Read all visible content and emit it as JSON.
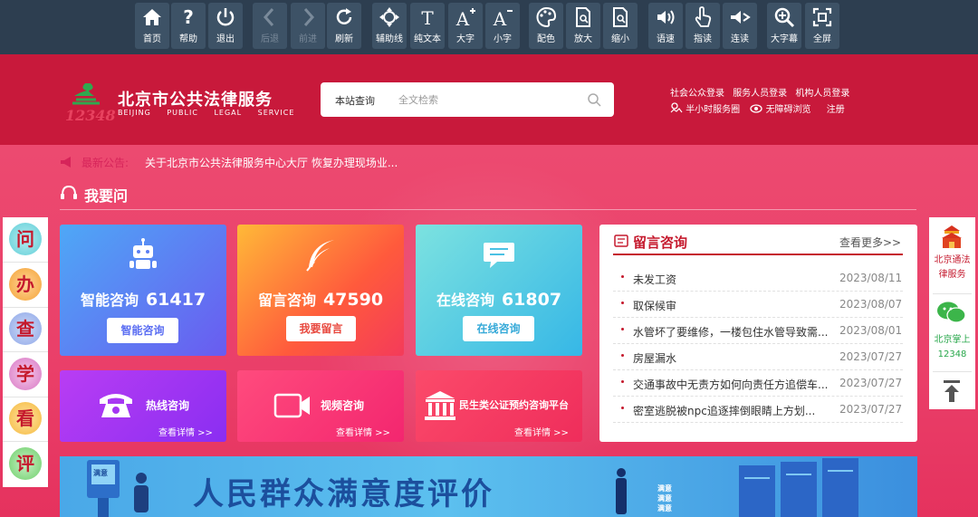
{
  "toolbar": [
    {
      "label": "首页",
      "icon": "home-icon",
      "disabled": false
    },
    {
      "label": "帮助",
      "icon": "help-icon",
      "disabled": false
    },
    {
      "label": "退出",
      "icon": "power-icon",
      "disabled": false
    },
    {
      "label": "后退",
      "icon": "chevron-left-icon",
      "disabled": true
    },
    {
      "label": "前进",
      "icon": "chevron-right-icon",
      "disabled": true
    },
    {
      "label": "刷新",
      "icon": "refresh-icon",
      "disabled": false
    },
    {
      "label": "辅助线",
      "icon": "crosshair-icon",
      "disabled": false
    },
    {
      "label": "纯文本",
      "icon": "text-icon",
      "disabled": false
    },
    {
      "label": "大字",
      "icon": "font-larger-icon",
      "disabled": false
    },
    {
      "label": "小字",
      "icon": "font-smaller-icon",
      "disabled": false
    },
    {
      "label": "配色",
      "icon": "palette-icon",
      "disabled": false
    },
    {
      "label": "放大",
      "icon": "zoom-in-page-icon",
      "disabled": false
    },
    {
      "label": "缩小",
      "icon": "zoom-out-page-icon",
      "disabled": false
    },
    {
      "label": "语速",
      "icon": "speaker-icon",
      "disabled": false
    },
    {
      "label": "指读",
      "icon": "pointer-read-icon",
      "disabled": false
    },
    {
      "label": "连读",
      "icon": "continuous-read-icon",
      "disabled": false
    },
    {
      "label": "大字幕",
      "icon": "magnifier-icon",
      "disabled": false
    },
    {
      "label": "全屏",
      "icon": "fullscreen-icon",
      "disabled": false
    }
  ],
  "header": {
    "logo_number": "12348",
    "title": "北京市公共法律服务",
    "subtitle": "BEIJING PUBLIC LEGAL SERVICE",
    "search_scope": "本站查询",
    "search_placeholder": "全文检索",
    "links": [
      "社会公众登录",
      "服务人员登录",
      "机构人员登录"
    ],
    "links2": [
      "半小时服务圈",
      "无障碍浏览",
      "注册"
    ]
  },
  "notice": {
    "label": "最新公告:",
    "text": "关于北京市公共法律服务中心大厅 恢复办理现场业..."
  },
  "section_title": "我要问",
  "side_nav": [
    "问",
    "办",
    "查",
    "学",
    "看",
    "评"
  ],
  "right_float": {
    "item1": [
      "北京通法",
      "律服务"
    ],
    "item2": [
      "北京掌上",
      "12348"
    ]
  },
  "cards": {
    "smart": {
      "title": "智能咨询",
      "count": "61417",
      "button": "智能咨询"
    },
    "message": {
      "title": "留言咨询",
      "count": "47590",
      "button": "我要留言"
    },
    "online": {
      "title": "在线咨询",
      "count": "61807",
      "button": "在线咨询"
    },
    "hotline": {
      "title": "热线咨询",
      "more": "查看详情 >>"
    },
    "video": {
      "title": "视频咨询",
      "more": "查看详情 >>"
    },
    "notary": {
      "title": "民生类公证预约咨询平台",
      "more": "查看详情 >>"
    }
  },
  "messages": {
    "title": "留言咨询",
    "more": "查看更多>>",
    "items": [
      {
        "title": "未发工资",
        "date": "2023/08/11"
      },
      {
        "title": "取保候审",
        "date": "2023/08/07"
      },
      {
        "title": "水管坏了要维修，一楼包住水管导致需...",
        "date": "2023/08/01"
      },
      {
        "title": "房屋漏水",
        "date": "2023/07/27"
      },
      {
        "title": "交通事故中无责方如何向责任方追偿车...",
        "date": "2023/07/27"
      },
      {
        "title": "密室逃脱被npc追逐摔倒眼睛上方划...",
        "date": "2023/07/27"
      }
    ]
  },
  "banner": {
    "title": "人民群众满意度评价",
    "screen_word": "满意"
  },
  "colors": {
    "toolbar_bg": "#2d3e50",
    "header_bg": "#c8193b",
    "accent_red": "#c5192d"
  }
}
